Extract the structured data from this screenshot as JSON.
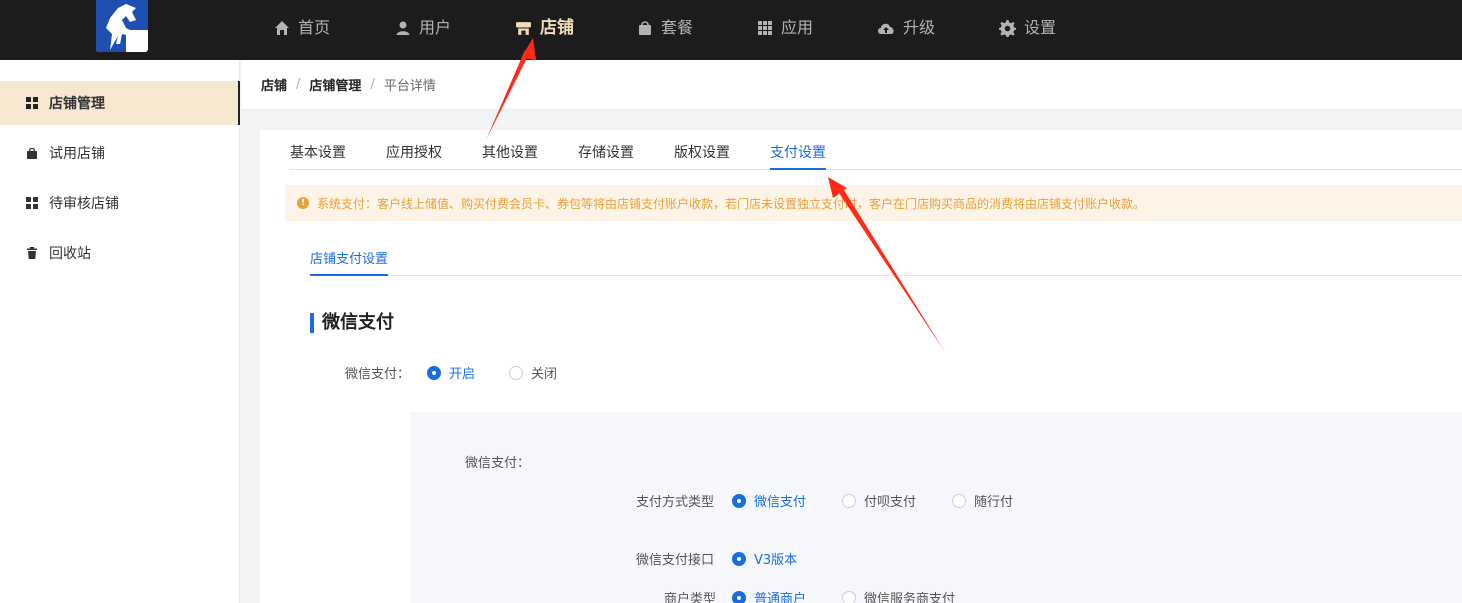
{
  "nav": {
    "items": [
      {
        "label": "首页",
        "icon": "home-icon"
      },
      {
        "label": "用户",
        "icon": "user-icon"
      },
      {
        "label": "店铺",
        "icon": "store-icon",
        "active": true
      },
      {
        "label": "套餐",
        "icon": "bag-icon"
      },
      {
        "label": "应用",
        "icon": "grid-icon"
      },
      {
        "label": "升级",
        "icon": "cloud-upload-icon"
      },
      {
        "label": "设置",
        "icon": "gear-icon"
      }
    ]
  },
  "sidebar": {
    "items": [
      {
        "label": "店铺管理",
        "icon": "grid-icon",
        "active": true
      },
      {
        "label": "试用店铺",
        "icon": "bag-icon"
      },
      {
        "label": "待审核店铺",
        "icon": "grid-icon"
      },
      {
        "label": "回收站",
        "icon": "trash-icon"
      }
    ]
  },
  "breadcrumb": {
    "items": [
      "店铺",
      "店铺管理",
      "平台详情"
    ],
    "separator": "/"
  },
  "tabs": [
    "基本设置",
    "应用授权",
    "其他设置",
    "存储设置",
    "版权设置",
    "支付设置"
  ],
  "notice": "系统支付：客户线上储值、购买付费会员卡、券包等将由店铺支付账户收款，若门店未设置独立支付时，客户在门店购买商品的消费将由店铺支付账户收款。",
  "subtab": "店铺支付设置",
  "section_title": "微信支付",
  "wechat_toggle": {
    "label": "微信支付：",
    "options": [
      "开启",
      "关闭"
    ]
  },
  "panel": {
    "title": "微信支付：",
    "rows": [
      {
        "label": "支付方式类型",
        "options": [
          "微信支付",
          "付呗支付",
          "随行付"
        ]
      },
      {
        "label": "微信支付接口",
        "options": [
          "V3版本"
        ]
      },
      {
        "label": "商户类型",
        "options": [
          "普通商户",
          "微信服务商支付"
        ]
      }
    ]
  },
  "colors": {
    "topbar": "#1c1c1e",
    "nav_active": "#f3ddb6",
    "accent": "#1a6de0",
    "notice_text": "#e6a23c",
    "arrow": "#ff2a1a"
  }
}
